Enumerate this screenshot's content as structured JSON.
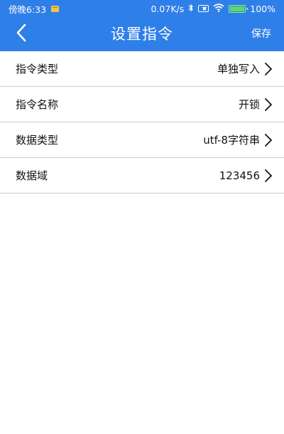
{
  "status_bar": {
    "time": "傍晚6:33",
    "network_speed": "0.07K/s",
    "battery_percent": "100%",
    "icons": [
      "notification-icon",
      "bluetooth-icon",
      "sim-icon",
      "wifi-icon",
      "battery-icon"
    ]
  },
  "header": {
    "title": "设置指令",
    "save_label": "保存",
    "back_icon": "chevron-left-icon"
  },
  "settings": [
    {
      "label": "指令类型",
      "value": "单独写入"
    },
    {
      "label": "指令名称",
      "value": "开锁"
    },
    {
      "label": "数据类型",
      "value": "utf-8字符串"
    },
    {
      "label": "数据域",
      "value": "123456"
    }
  ],
  "colors": {
    "brand": "#2f7fe8",
    "background": "#ffffff",
    "divider": "#cfcfcf",
    "text": "#111111"
  }
}
